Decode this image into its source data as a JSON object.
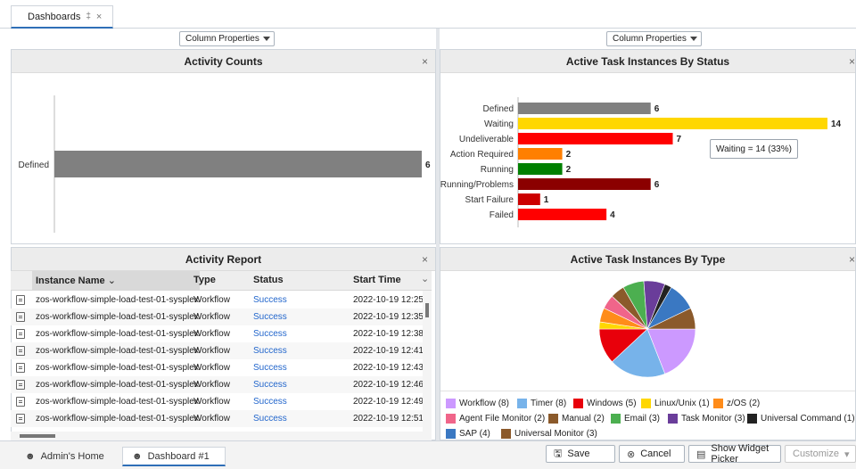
{
  "top_tab": {
    "label": "Dashboards",
    "pin": "‡",
    "close": "×"
  },
  "column_properties": {
    "left_label": "Column Properties",
    "right_label": "Column Properties"
  },
  "activity_counts": {
    "title": "Activity Counts",
    "close": "×"
  },
  "task_status": {
    "title": "Active Task Instances By Status",
    "close": "×",
    "tooltip": "Waiting = 14 (33%)"
  },
  "activity_report": {
    "title": "Activity Report",
    "close": "×",
    "columns": [
      "Instance Name",
      "Type",
      "Status",
      "Start Time"
    ],
    "rows": [
      [
        "zos-workflow-simple-load-test-01-sysplex",
        "Workflow",
        "Success",
        "2022-10-19 12:25:"
      ],
      [
        "zos-workflow-simple-load-test-01-sysplex",
        "Workflow",
        "Success",
        "2022-10-19 12:35:"
      ],
      [
        "zos-workflow-simple-load-test-01-sysplex",
        "Workflow",
        "Success",
        "2022-10-19 12:38:"
      ],
      [
        "zos-workflow-simple-load-test-01-sysplex",
        "Workflow",
        "Success",
        "2022-10-19 12:41:"
      ],
      [
        "zos-workflow-simple-load-test-01-sysplex",
        "Workflow",
        "Success",
        "2022-10-19 12:43:"
      ],
      [
        "zos-workflow-simple-load-test-01-sysplex",
        "Workflow",
        "Success",
        "2022-10-19 12:46:"
      ],
      [
        "zos-workflow-simple-load-test-01-sysplex",
        "Workflow",
        "Success",
        "2022-10-19 12:49:"
      ],
      [
        "zos-workflow-simple-load-test-01-sysplex",
        "Workflow",
        "Success",
        "2022-10-19 12:51:"
      ]
    ]
  },
  "task_type": {
    "title": "Active Task Instances By Type",
    "close": "×"
  },
  "bottom": {
    "tab_home": "Admin's Home",
    "tab_dashboard": "Dashboard #1",
    "save": "Save",
    "cancel": "Cancel",
    "show_widget_picker": "Show Widget Picker",
    "customize": "Customize"
  },
  "chart_data": [
    {
      "type": "bar",
      "orientation": "horizontal",
      "title": "Activity Counts",
      "categories": [
        "Defined"
      ],
      "values": [
        6
      ],
      "colors": [
        "#808080"
      ],
      "data_labels": [
        "6"
      ],
      "xlim": [
        0,
        6
      ]
    },
    {
      "type": "bar",
      "orientation": "horizontal",
      "title": "Active Task Instances By Status",
      "categories": [
        "Defined",
        "Waiting",
        "Undeliverable",
        "Action Required",
        "Running",
        "Running/Problems",
        "Start Failure",
        "Failed"
      ],
      "values": [
        6,
        14,
        7,
        2,
        2,
        6,
        1,
        4
      ],
      "colors": [
        "#808080",
        "#ffd700",
        "#ff0000",
        "#ff7f00",
        "#008000",
        "#8b0000",
        "#cc0000",
        "#ff0000"
      ],
      "data_labels": [
        "6",
        "14",
        "7",
        "2",
        "2",
        "6",
        "1",
        "4"
      ],
      "xlim": [
        0,
        14
      ]
    },
    {
      "type": "pie",
      "title": "Active Task Instances By Type",
      "legend_position": "bottom",
      "series": [
        {
          "name": "Workflow",
          "value": 8,
          "color": "#cc99ff",
          "label": "Workflow (8)"
        },
        {
          "name": "Timer",
          "value": 8,
          "color": "#77b3ea",
          "label": "Timer (8)"
        },
        {
          "name": "Windows",
          "value": 5,
          "color": "#e8000b",
          "label": "Windows (5)"
        },
        {
          "name": "Linux/Unix",
          "value": 1,
          "color": "#ffd700",
          "label": "Linux/Unix (1)"
        },
        {
          "name": "z/OS",
          "value": 2,
          "color": "#ff8c1a",
          "label": "z/OS (2)"
        },
        {
          "name": "Agent File Monitor",
          "value": 2,
          "color": "#f0658a",
          "label": "Agent File Monitor (2)"
        },
        {
          "name": "Manual",
          "value": 2,
          "color": "#8b5a2b",
          "label": "Manual (2)"
        },
        {
          "name": "Email",
          "value": 3,
          "color": "#4caf50",
          "label": "Email (3)"
        },
        {
          "name": "Task Monitor",
          "value": 3,
          "color": "#6a3d9a",
          "label": "Task Monitor (3)"
        },
        {
          "name": "Universal Command",
          "value": 1,
          "color": "#222222",
          "label": "Universal Command (1)"
        },
        {
          "name": "SAP",
          "value": 4,
          "color": "#3a78c2",
          "label": "SAP (4)"
        },
        {
          "name": "Universal Monitor",
          "value": 3,
          "color": "#8b5a2b",
          "label": "Universal Monitor (3)"
        }
      ]
    }
  ]
}
